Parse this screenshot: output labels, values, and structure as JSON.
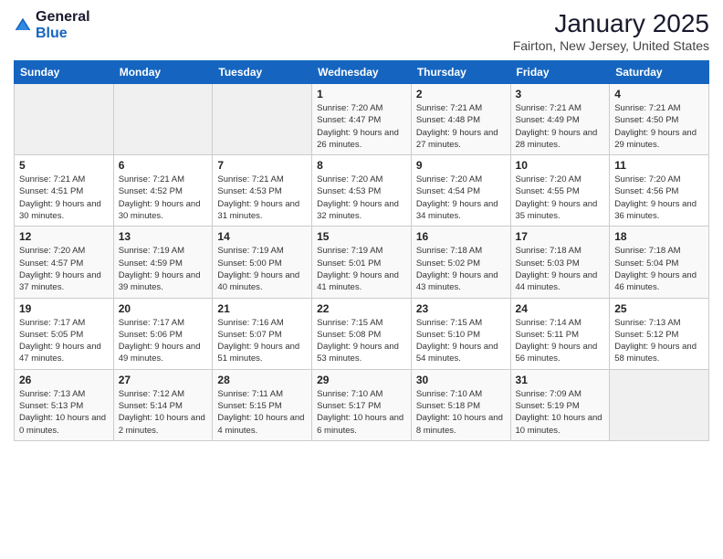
{
  "logo": {
    "general": "General",
    "blue": "Blue"
  },
  "title": "January 2025",
  "subtitle": "Fairton, New Jersey, United States",
  "days_of_week": [
    "Sunday",
    "Monday",
    "Tuesday",
    "Wednesday",
    "Thursday",
    "Friday",
    "Saturday"
  ],
  "weeks": [
    [
      {
        "day": "",
        "info": ""
      },
      {
        "day": "",
        "info": ""
      },
      {
        "day": "",
        "info": ""
      },
      {
        "day": "1",
        "info": "Sunrise: 7:20 AM\nSunset: 4:47 PM\nDaylight: 9 hours and 26 minutes."
      },
      {
        "day": "2",
        "info": "Sunrise: 7:21 AM\nSunset: 4:48 PM\nDaylight: 9 hours and 27 minutes."
      },
      {
        "day": "3",
        "info": "Sunrise: 7:21 AM\nSunset: 4:49 PM\nDaylight: 9 hours and 28 minutes."
      },
      {
        "day": "4",
        "info": "Sunrise: 7:21 AM\nSunset: 4:50 PM\nDaylight: 9 hours and 29 minutes."
      }
    ],
    [
      {
        "day": "5",
        "info": "Sunrise: 7:21 AM\nSunset: 4:51 PM\nDaylight: 9 hours and 30 minutes."
      },
      {
        "day": "6",
        "info": "Sunrise: 7:21 AM\nSunset: 4:52 PM\nDaylight: 9 hours and 30 minutes."
      },
      {
        "day": "7",
        "info": "Sunrise: 7:21 AM\nSunset: 4:53 PM\nDaylight: 9 hours and 31 minutes."
      },
      {
        "day": "8",
        "info": "Sunrise: 7:20 AM\nSunset: 4:53 PM\nDaylight: 9 hours and 32 minutes."
      },
      {
        "day": "9",
        "info": "Sunrise: 7:20 AM\nSunset: 4:54 PM\nDaylight: 9 hours and 34 minutes."
      },
      {
        "day": "10",
        "info": "Sunrise: 7:20 AM\nSunset: 4:55 PM\nDaylight: 9 hours and 35 minutes."
      },
      {
        "day": "11",
        "info": "Sunrise: 7:20 AM\nSunset: 4:56 PM\nDaylight: 9 hours and 36 minutes."
      }
    ],
    [
      {
        "day": "12",
        "info": "Sunrise: 7:20 AM\nSunset: 4:57 PM\nDaylight: 9 hours and 37 minutes."
      },
      {
        "day": "13",
        "info": "Sunrise: 7:19 AM\nSunset: 4:59 PM\nDaylight: 9 hours and 39 minutes."
      },
      {
        "day": "14",
        "info": "Sunrise: 7:19 AM\nSunset: 5:00 PM\nDaylight: 9 hours and 40 minutes."
      },
      {
        "day": "15",
        "info": "Sunrise: 7:19 AM\nSunset: 5:01 PM\nDaylight: 9 hours and 41 minutes."
      },
      {
        "day": "16",
        "info": "Sunrise: 7:18 AM\nSunset: 5:02 PM\nDaylight: 9 hours and 43 minutes."
      },
      {
        "day": "17",
        "info": "Sunrise: 7:18 AM\nSunset: 5:03 PM\nDaylight: 9 hours and 44 minutes."
      },
      {
        "day": "18",
        "info": "Sunrise: 7:18 AM\nSunset: 5:04 PM\nDaylight: 9 hours and 46 minutes."
      }
    ],
    [
      {
        "day": "19",
        "info": "Sunrise: 7:17 AM\nSunset: 5:05 PM\nDaylight: 9 hours and 47 minutes."
      },
      {
        "day": "20",
        "info": "Sunrise: 7:17 AM\nSunset: 5:06 PM\nDaylight: 9 hours and 49 minutes."
      },
      {
        "day": "21",
        "info": "Sunrise: 7:16 AM\nSunset: 5:07 PM\nDaylight: 9 hours and 51 minutes."
      },
      {
        "day": "22",
        "info": "Sunrise: 7:15 AM\nSunset: 5:08 PM\nDaylight: 9 hours and 53 minutes."
      },
      {
        "day": "23",
        "info": "Sunrise: 7:15 AM\nSunset: 5:10 PM\nDaylight: 9 hours and 54 minutes."
      },
      {
        "day": "24",
        "info": "Sunrise: 7:14 AM\nSunset: 5:11 PM\nDaylight: 9 hours and 56 minutes."
      },
      {
        "day": "25",
        "info": "Sunrise: 7:13 AM\nSunset: 5:12 PM\nDaylight: 9 hours and 58 minutes."
      }
    ],
    [
      {
        "day": "26",
        "info": "Sunrise: 7:13 AM\nSunset: 5:13 PM\nDaylight: 10 hours and 0 minutes."
      },
      {
        "day": "27",
        "info": "Sunrise: 7:12 AM\nSunset: 5:14 PM\nDaylight: 10 hours and 2 minutes."
      },
      {
        "day": "28",
        "info": "Sunrise: 7:11 AM\nSunset: 5:15 PM\nDaylight: 10 hours and 4 minutes."
      },
      {
        "day": "29",
        "info": "Sunrise: 7:10 AM\nSunset: 5:17 PM\nDaylight: 10 hours and 6 minutes."
      },
      {
        "day": "30",
        "info": "Sunrise: 7:10 AM\nSunset: 5:18 PM\nDaylight: 10 hours and 8 minutes."
      },
      {
        "day": "31",
        "info": "Sunrise: 7:09 AM\nSunset: 5:19 PM\nDaylight: 10 hours and 10 minutes."
      },
      {
        "day": "",
        "info": ""
      }
    ]
  ]
}
